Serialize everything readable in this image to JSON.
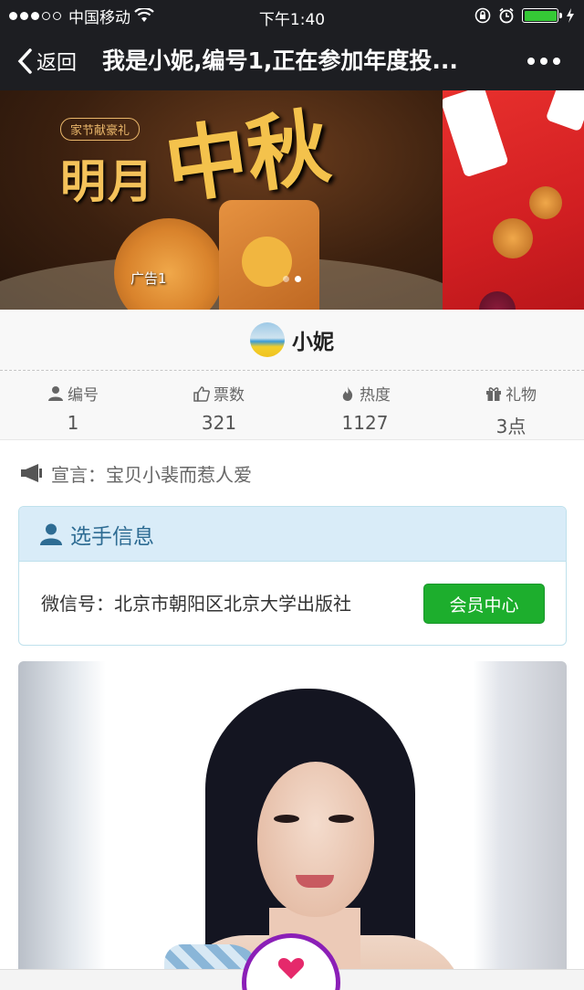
{
  "status_bar": {
    "carrier": "中国移动",
    "time": "下午1:40"
  },
  "nav": {
    "back_label": "返回",
    "title": "我是小妮,编号1,正在参加年度投..."
  },
  "banner": {
    "slide_label": "广告1",
    "sub_text": "家节献豪礼",
    "main_text": "明月",
    "big_text": "中秋"
  },
  "profile": {
    "name": "小妮"
  },
  "stats": [
    {
      "label": "编号",
      "value": "1",
      "icon": "person-icon"
    },
    {
      "label": "票数",
      "value": "321",
      "icon": "thumbs-up-icon"
    },
    {
      "label": "热度",
      "value": "1127",
      "icon": "fire-icon"
    },
    {
      "label": "礼物",
      "value": "3点",
      "icon": "gift-icon"
    }
  ],
  "declaration": {
    "text": "宣言：宝贝小裴而惹人爱",
    "icon": "megaphone-icon"
  },
  "info_panel": {
    "title": "选手信息",
    "wechat": "微信号：北京市朝阳区北京大学出版社",
    "member_button": "会员中心"
  },
  "colors": {
    "nav_bg": "#1d1e22",
    "panel_head_bg": "#d9ecf8",
    "panel_title": "#2e6c93",
    "member_button": "#1dae2d",
    "vote_ring": "#8b1fb7",
    "heart": "#e5296b",
    "battery": "#35c936"
  }
}
